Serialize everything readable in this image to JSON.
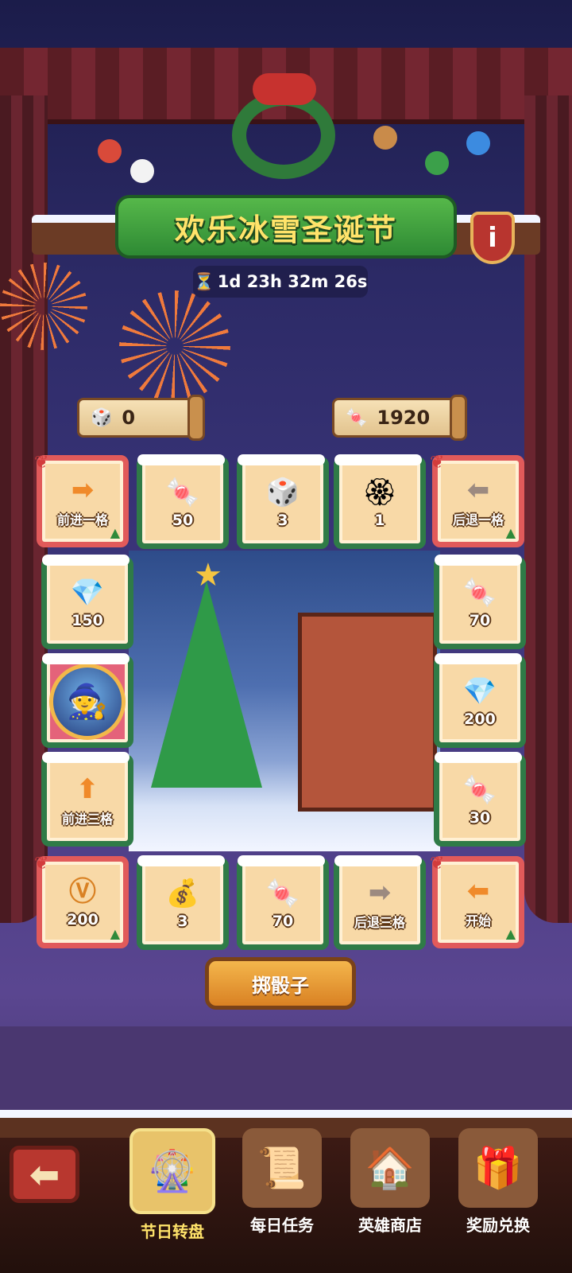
{
  "event": {
    "title": "欢乐冰雪圣诞节",
    "timer": "1d 23h 32m 26s",
    "info_icon": "i"
  },
  "counters": {
    "dice": "0",
    "candy": "1920"
  },
  "board": {
    "top": [
      {
        "icon": "➡",
        "label": "前进一格",
        "color": "#f08a2a"
      },
      {
        "icon": "🍬",
        "label": "50"
      },
      {
        "icon": "🎲",
        "label": "3"
      },
      {
        "icon": "🏵",
        "label": "1"
      },
      {
        "icon": "⬅",
        "label": "后退一格",
        "color": "#9c8a80"
      }
    ],
    "left": [
      {
        "icon": "💎",
        "label": "150"
      },
      {
        "icon": "🧙",
        "label": ""
      },
      {
        "icon": "⬆",
        "label": "前进三格",
        "color": "#f08a2a"
      }
    ],
    "right": [
      {
        "icon": "🍬",
        "label": "70"
      },
      {
        "icon": "💎",
        "label": "200"
      },
      {
        "icon": "🍬",
        "label": "30"
      }
    ],
    "bottom": [
      {
        "icon": "Ⓥ",
        "label": "200"
      },
      {
        "icon": "💰",
        "label": "3"
      },
      {
        "icon": "🍬",
        "label": "70"
      },
      {
        "icon": "➡",
        "label": "后退三格",
        "color": "#9c8a80"
      },
      {
        "icon": "⬅",
        "label": "开始",
        "color": "#f08a2a"
      }
    ]
  },
  "roll_button": "掷骰子",
  "bottom_nav": [
    {
      "label": "节日转盘",
      "icon": "🎡",
      "active": true
    },
    {
      "label": "每日任务",
      "icon": "📜",
      "active": false
    },
    {
      "label": "英雄商店",
      "icon": "🏠",
      "active": false
    },
    {
      "label": "奖励兑换",
      "icon": "🎁",
      "active": false
    }
  ],
  "back_icon": "⬅"
}
